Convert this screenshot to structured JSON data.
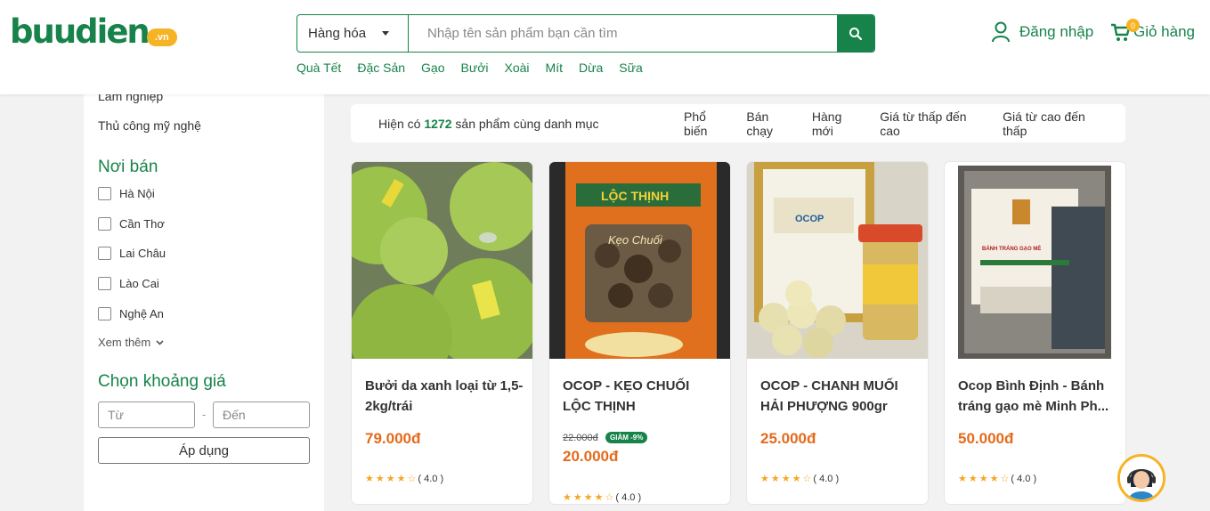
{
  "header": {
    "logo_text": "buudien",
    "logo_suffix": ".vn",
    "search": {
      "category": "Hàng hóa",
      "placeholder": "Nhập tên sản phẩm bạn cần tìm"
    },
    "quick_links": [
      "Quà Tết",
      "Đặc Sản",
      "Gạo",
      "Bưởi",
      "Xoài",
      "Mít",
      "Dừa",
      "Sữa"
    ],
    "login_label": "Đăng nhập",
    "cart_label": "Giỏ hàng",
    "cart_count": "0"
  },
  "sidebar": {
    "categories": [
      "Lâm nghiệp",
      "Thủ công mỹ nghệ"
    ],
    "region_title": "Nơi bán",
    "regions": [
      "Hà Nội",
      "Cần Thơ",
      "Lai Châu",
      "Lào Cai",
      "Nghệ An"
    ],
    "see_more": "Xem thêm",
    "price_title": "Chọn khoảng giá",
    "price_from_placeholder": "Từ",
    "price_to_placeholder": "Đến",
    "price_dash": "-",
    "apply_label": "Áp dụng"
  },
  "sortbar": {
    "count_prefix": "Hiện có",
    "count": "1272",
    "count_suffix": "sản phẩm cùng danh mục",
    "options": [
      "Phổ biến",
      "Bán chạy",
      "Hàng mới",
      "Giá từ thấp đến cao",
      "Giá từ cao đến thấp"
    ]
  },
  "products": [
    {
      "name": "Bưởi da xanh loại từ 1,5-2kg/trái",
      "price": "79.000đ",
      "old_price": "",
      "discount": "",
      "rating": "( 4.0 )"
    },
    {
      "name": "OCOP - KẸO CHUỐI LỘC THỊNH",
      "price": "20.000đ",
      "old_price": "22.000đ",
      "discount": "GIẢM -9%",
      "rating": "( 4.0 )"
    },
    {
      "name": "OCOP - CHANH MUỐI HẢI PHƯỢNG 900gr",
      "price": "25.000đ",
      "old_price": "",
      "discount": "",
      "rating": "( 4.0 )"
    },
    {
      "name": "Ocop Bình Định - Bánh tráng gạo mè Minh Ph...",
      "price": "50.000đ",
      "old_price": "",
      "discount": "",
      "rating": "( 4.0 )"
    }
  ],
  "product_images": {
    "p1_text": "",
    "p2_brand": "LỘC THỊNH",
    "p2_sub": "Kẹo Chuối",
    "p3_cert": "OCOP",
    "p4_label": "BÁNH TRÁNG GẠO MÈ"
  },
  "colors": {
    "brand_green": "#17834a",
    "accent_orange": "#e56a1b",
    "logo_yellow": "#f6b323"
  }
}
